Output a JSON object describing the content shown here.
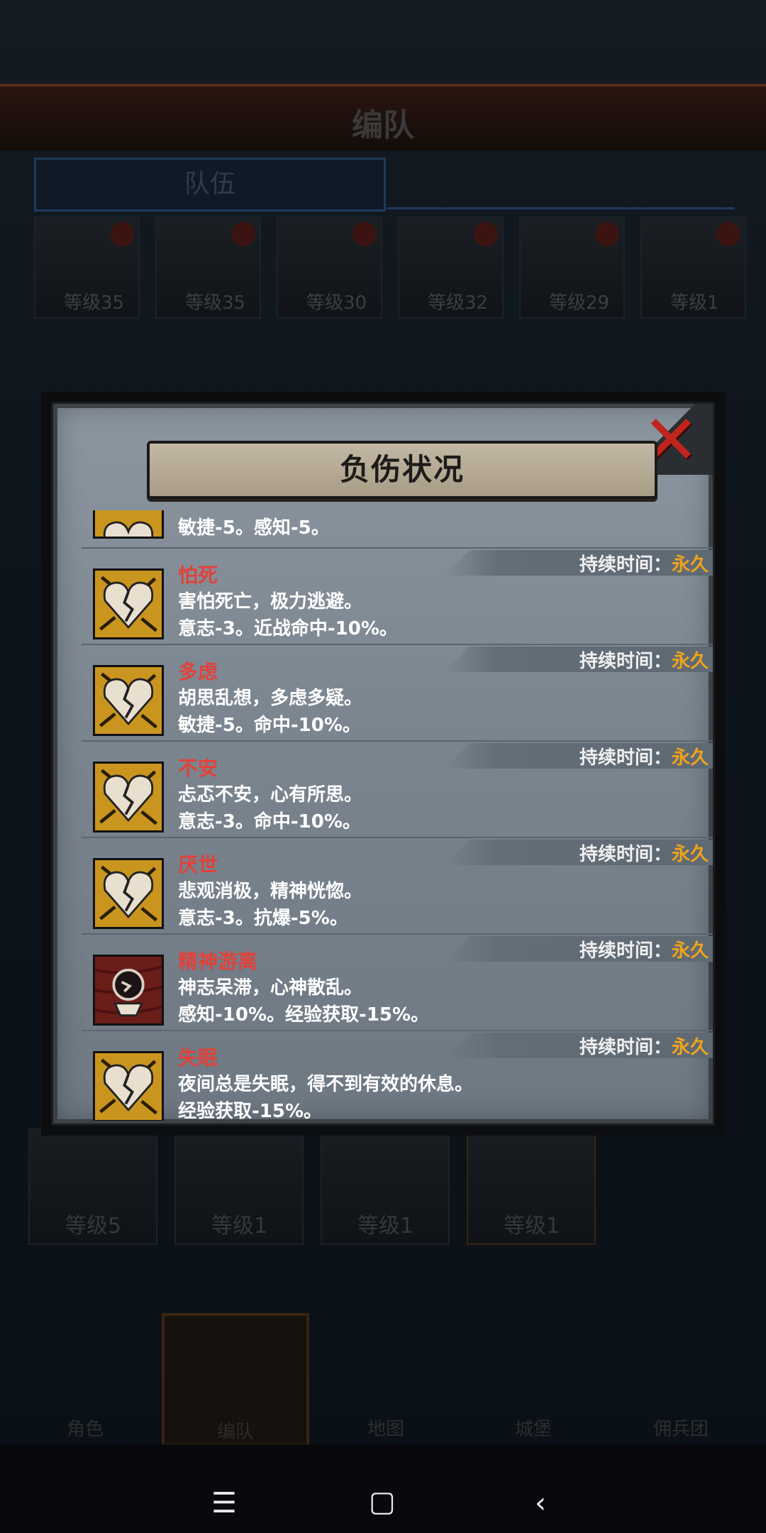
{
  "background": {
    "title": "编队",
    "tab": "队伍",
    "top_heroes": [
      {
        "level": "等级35"
      },
      {
        "level": "等级35"
      },
      {
        "level": "等级30"
      },
      {
        "level": "等级32"
      },
      {
        "level": "等级29"
      },
      {
        "level": "等级1"
      }
    ],
    "bottom_heroes": [
      {
        "level": "等级5"
      },
      {
        "level": "等级1"
      },
      {
        "level": "等级1"
      },
      {
        "level": "等级1"
      }
    ],
    "nav": [
      {
        "label": "角色"
      },
      {
        "label": "编队"
      },
      {
        "label": "地图"
      },
      {
        "label": "城堡"
      },
      {
        "label": "佣兵团"
      }
    ]
  },
  "modal": {
    "title": "负伤状况",
    "close_icon": "close-x-icon",
    "duration_label": "持续时间：",
    "partial_entry": {
      "stats": "敏捷-5。感知-5。",
      "icon": "broken-heart-icon"
    },
    "entries": [
      {
        "name": "怕死",
        "desc": "害怕死亡，极力逃避。",
        "stats": "意志-3。近战命中-10%。",
        "duration": "永久",
        "icon": "broken-heart-icon"
      },
      {
        "name": "多虑",
        "desc": "胡思乱想，多虑多疑。",
        "stats": "敏捷-5。命中-10%。",
        "duration": "永久",
        "icon": "broken-heart-icon"
      },
      {
        "name": "不安",
        "desc": "忐忑不安，心有所思。",
        "stats": "意志-3。命中-10%。",
        "duration": "永久",
        "icon": "broken-heart-icon"
      },
      {
        "name": "厌世",
        "desc": "悲观消极，精神恍惚。",
        "stats": "意志-3。抗爆-5%。",
        "duration": "永久",
        "icon": "broken-heart-icon"
      },
      {
        "name": "精神游离",
        "desc": "神志呆滞，心神散乱。",
        "stats": "感知-10%。经验获取-15%。",
        "duration": "永久",
        "icon": "shattered-mind-icon"
      },
      {
        "name": "失眠",
        "desc": "夜间总是失眠，得不到有效的休息。",
        "stats": "经验获取-15%。",
        "duration": "永久",
        "icon": "broken-heart-icon"
      }
    ]
  },
  "colors": {
    "debuff_name": "#e0423a",
    "duration_value": "#f0a31c",
    "icon_gold": "#c9951e",
    "icon_red": "#6b1d1a"
  }
}
